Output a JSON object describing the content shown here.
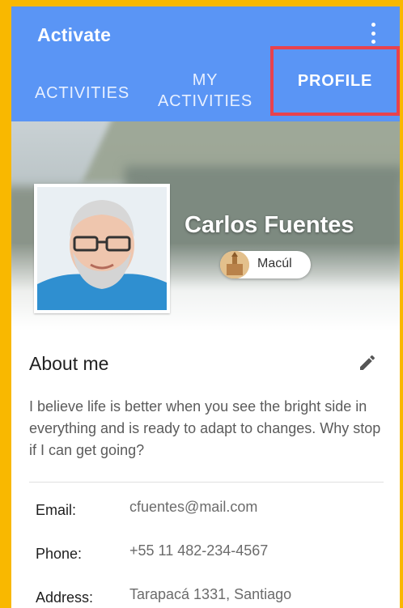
{
  "app": {
    "title": "Activate"
  },
  "tabs": [
    {
      "label": "ACTIVITIES"
    },
    {
      "label_line1": "MY",
      "label_line2": "ACTIVITIES"
    },
    {
      "label": "PROFILE",
      "selected": true
    }
  ],
  "profile": {
    "name": "Carlos Fuentes",
    "location": "Macúl"
  },
  "about": {
    "title": "About me",
    "text": "I believe life is better when you see the bright side in everything and is ready to adapt to changes. Why stop if I can get going?"
  },
  "details": [
    {
      "label": "Email:",
      "value": "cfuentes@mail.com"
    },
    {
      "label": "Phone:",
      "value": "+55 11 482-234-4567"
    },
    {
      "label": "Address:",
      "value": "Tarapacá 1331, Santiago"
    }
  ],
  "colors": {
    "accent": "#5A95F5",
    "outer_border": "#F9B800",
    "highlight": "#E8424D"
  },
  "icons": {
    "menu": "more-vert-icon",
    "edit": "pencil-icon"
  }
}
